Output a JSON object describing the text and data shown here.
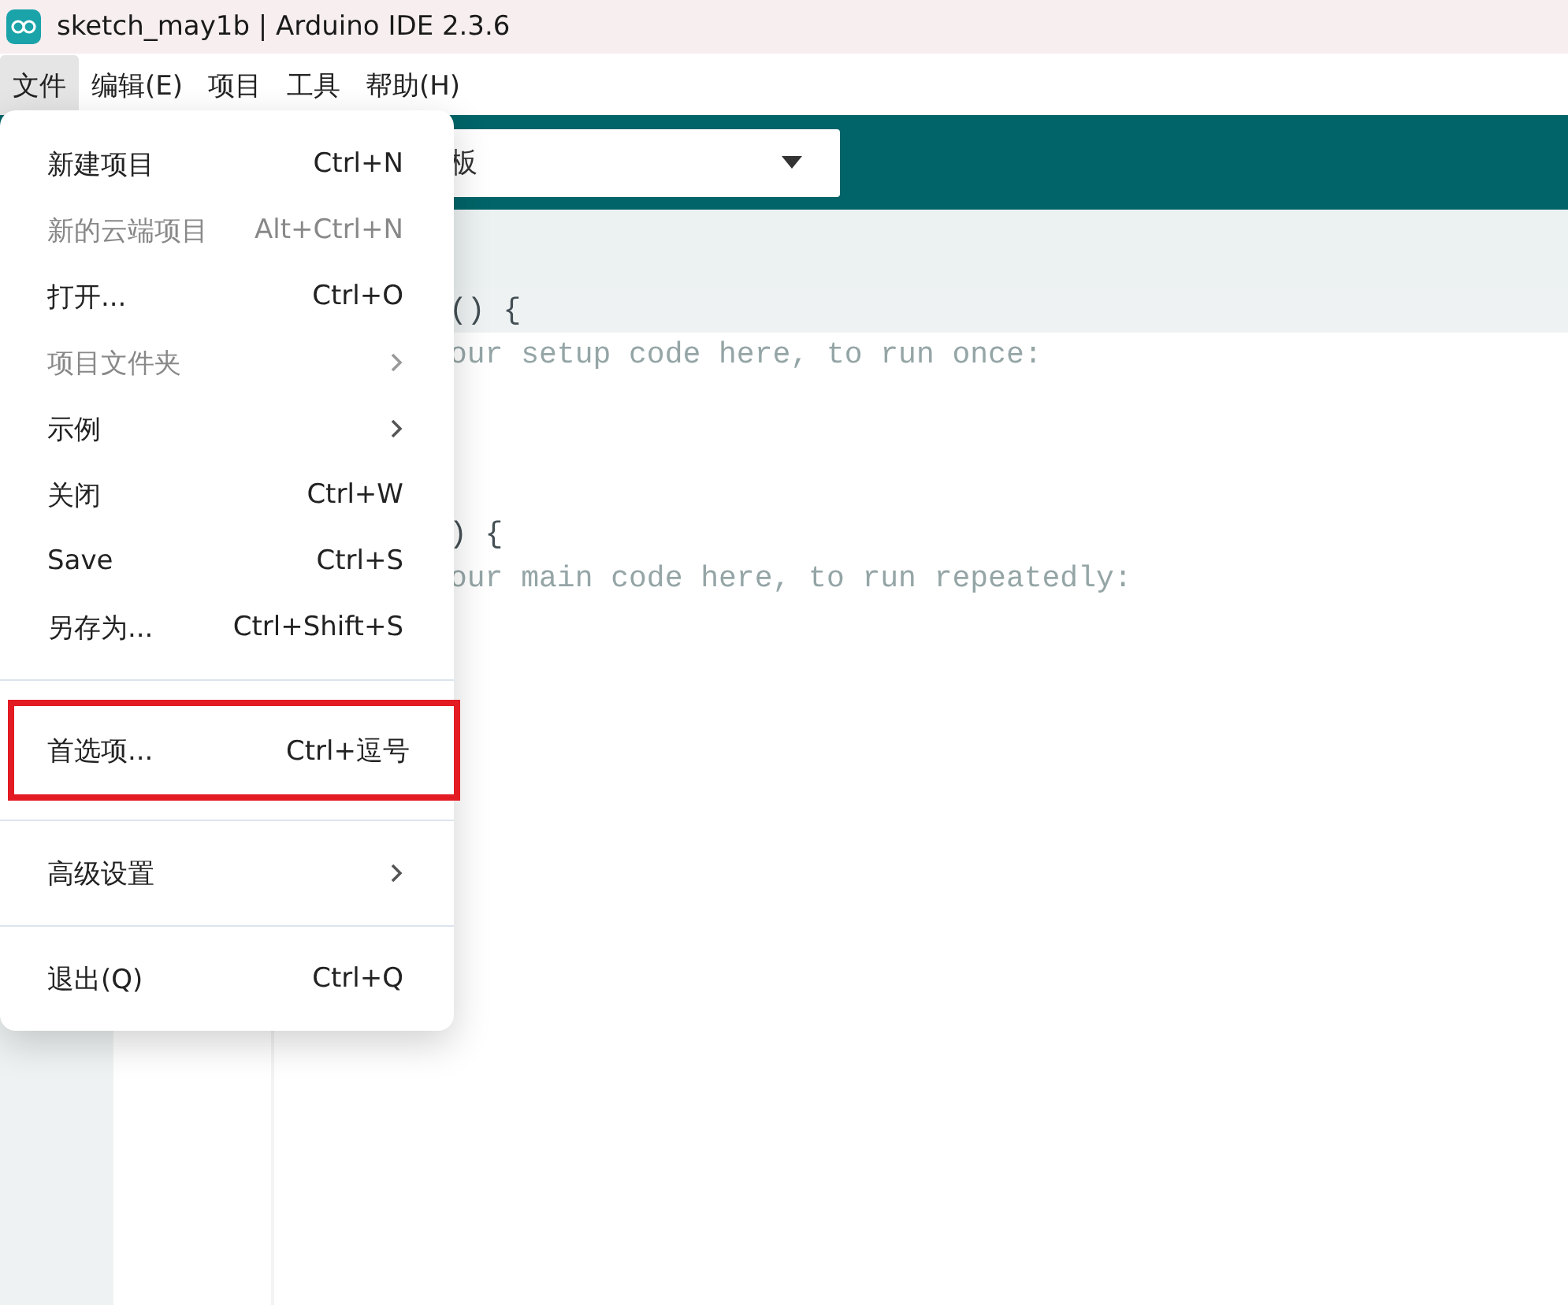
{
  "window": {
    "title": "sketch_may1b | Arduino IDE 2.3.6"
  },
  "menubar": [
    {
      "label": "文件",
      "selected": true
    },
    {
      "label": "编辑(E)",
      "selected": false
    },
    {
      "label": "项目",
      "selected": false
    },
    {
      "label": "工具",
      "selected": false
    },
    {
      "label": "帮助(H)",
      "selected": false
    }
  ],
  "toolbar": {
    "board_select": {
      "value": "板"
    }
  },
  "editor": {
    "blocks": [
      {
        "lines": [
          {
            "text": "() {",
            "kind": "code",
            "highlighted": true
          },
          {
            "text": "our setup code here, to run once:",
            "kind": "comment",
            "highlighted": false
          }
        ]
      },
      {
        "lines": [
          {
            "text": ") {",
            "kind": "code",
            "highlighted": false
          },
          {
            "text": "our main code here, to run repeatedly:",
            "kind": "comment",
            "highlighted": false
          }
        ]
      }
    ]
  },
  "file_menu": {
    "items": [
      {
        "kind": "item",
        "label": "新建项目",
        "shortcut": "Ctrl+N",
        "disabled": false,
        "highlighted": false
      },
      {
        "kind": "item",
        "label": "新的云端项目",
        "shortcut": "Alt+Ctrl+N",
        "disabled": true,
        "highlighted": false
      },
      {
        "kind": "item",
        "label": "打开...",
        "shortcut": "Ctrl+O",
        "disabled": false,
        "highlighted": false
      },
      {
        "kind": "submenu",
        "label": "项目文件夹",
        "disabled": true,
        "highlighted": false
      },
      {
        "kind": "submenu",
        "label": "示例",
        "disabled": false,
        "highlighted": false
      },
      {
        "kind": "item",
        "label": "关闭",
        "shortcut": "Ctrl+W",
        "disabled": false,
        "highlighted": false
      },
      {
        "kind": "item",
        "label": "Save",
        "shortcut": "Ctrl+S",
        "disabled": false,
        "highlighted": false
      },
      {
        "kind": "item",
        "label": "另存为...",
        "shortcut": "Ctrl+Shift+S",
        "disabled": false,
        "highlighted": false
      },
      {
        "kind": "separator"
      },
      {
        "kind": "item",
        "label": "首选项...",
        "shortcut": "Ctrl+逗号",
        "disabled": false,
        "highlighted": true
      },
      {
        "kind": "separator"
      },
      {
        "kind": "submenu",
        "label": "高级设置",
        "disabled": false,
        "highlighted": false
      },
      {
        "kind": "separator"
      },
      {
        "kind": "item",
        "label": "退出(Q)",
        "shortcut": "Ctrl+Q",
        "disabled": false,
        "highlighted": false
      }
    ]
  }
}
